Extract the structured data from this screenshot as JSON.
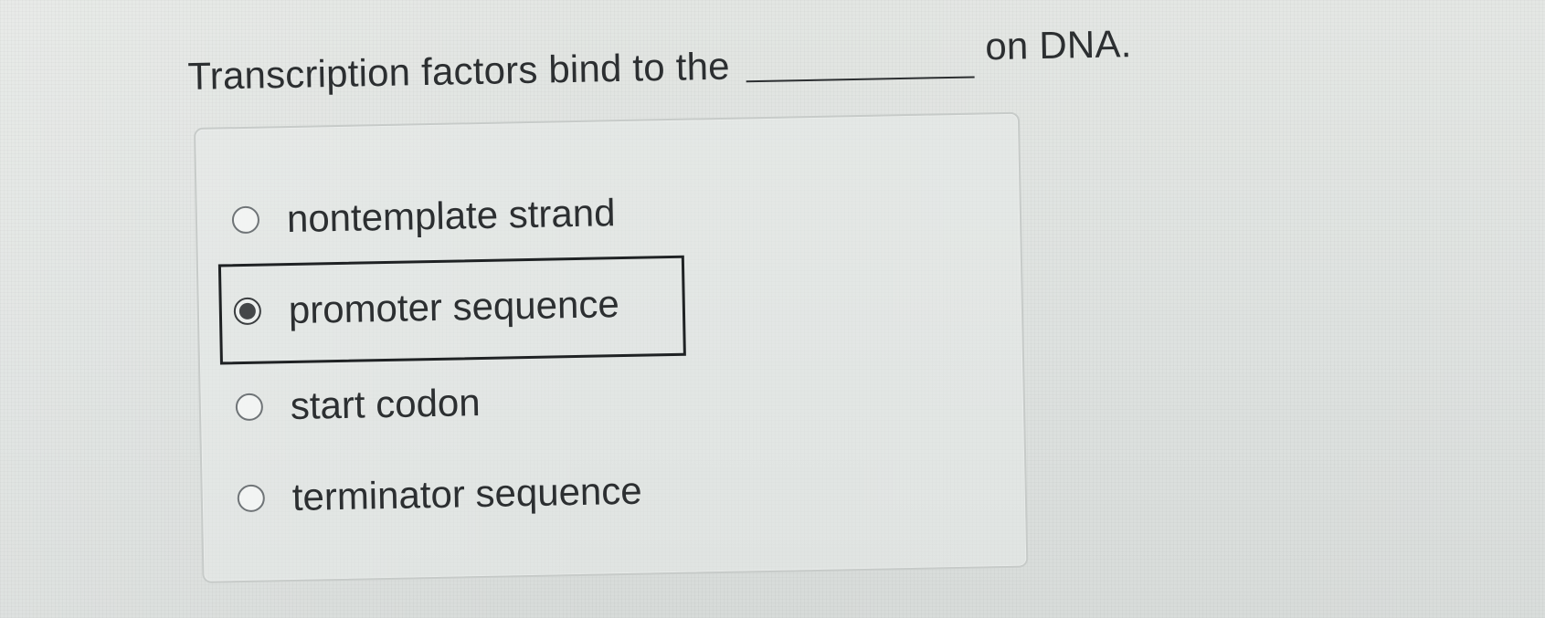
{
  "question": {
    "text_before": "Transcription factors bind to the",
    "text_after": "on DNA."
  },
  "options": [
    {
      "label": "nontemplate strand",
      "selected": false
    },
    {
      "label": "promoter sequence",
      "selected": true
    },
    {
      "label": "start codon",
      "selected": false
    },
    {
      "label": "terminator sequence",
      "selected": false
    }
  ],
  "colors": {
    "text": "#2c2f31",
    "focus_outline": "#1f2224",
    "radio_fill": "#444749"
  }
}
